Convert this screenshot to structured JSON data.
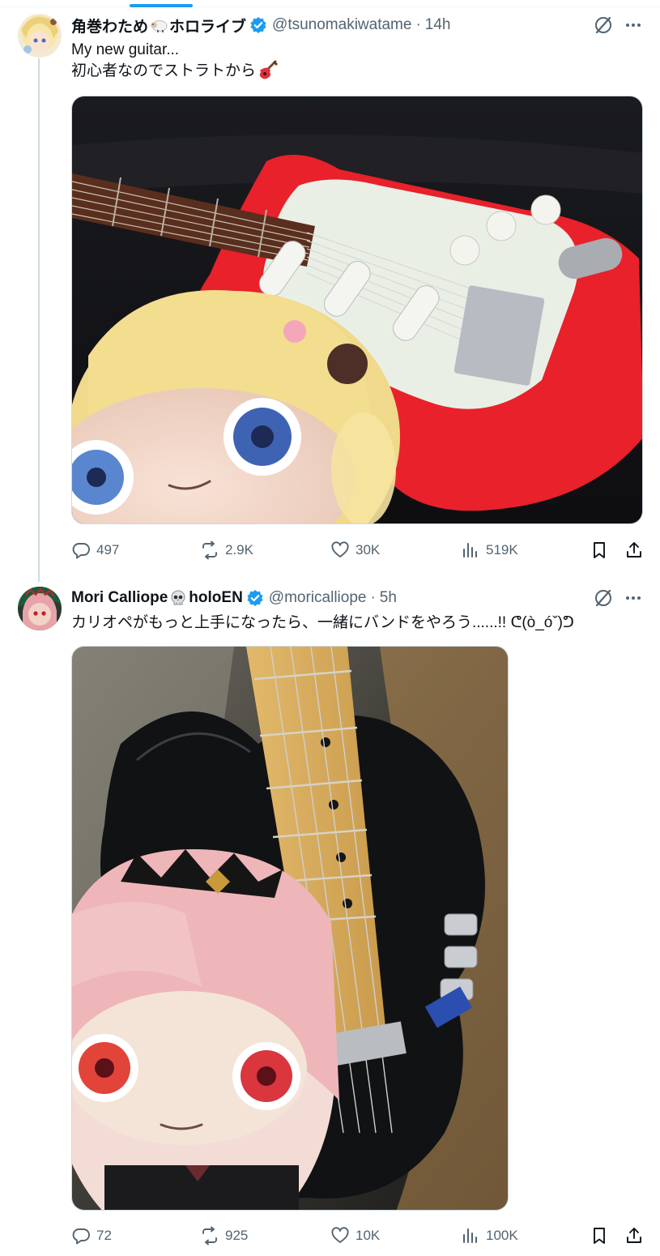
{
  "tweets": [
    {
      "name": "角巻わため",
      "name_suffix": "ホロライブ",
      "handle": "@tsunomakiwatame",
      "time": "14h",
      "text_line1": "My new guitar...",
      "text_line2": "初心者なのでストラトから",
      "stats": {
        "replies": "497",
        "reposts": "2.9K",
        "likes": "30K",
        "views": "519K"
      }
    },
    {
      "name": "Mori Calliope",
      "name_suffix": "holoEN",
      "handle": "@moricalliope",
      "time": "5h",
      "text_line1": "カリオペがもっと上手になったら、一緒にバンドをやろう......!! ᕦ(ò_óˇ)ᕤ",
      "stats": {
        "replies": "72",
        "reposts": "925",
        "likes": "10K",
        "views": "100K"
      }
    }
  ],
  "separator": "·",
  "icons": {
    "reply": "reply-icon",
    "repost": "repost-icon",
    "like": "heart-icon",
    "views": "views-icon",
    "bookmark": "bookmark-icon",
    "share": "share-icon",
    "grok": "grok-icon",
    "more": "more-icon",
    "verified": "verified-badge-icon"
  },
  "colors": {
    "accent": "#1d9bf0",
    "text": "#0f1419",
    "secondary": "#536471",
    "border": "#cfd9de"
  }
}
